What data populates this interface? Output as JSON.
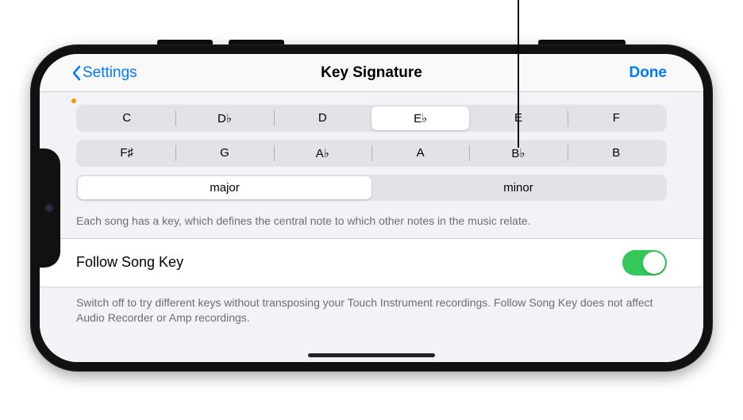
{
  "navbar": {
    "back_label": "Settings",
    "title": "Key Signature",
    "done_label": "Done"
  },
  "keys_row1": [
    {
      "label": "C",
      "selected": false
    },
    {
      "label": "D♭",
      "selected": false
    },
    {
      "label": "D",
      "selected": false
    },
    {
      "label": "E♭",
      "selected": true
    },
    {
      "label": "E",
      "selected": false
    },
    {
      "label": "F",
      "selected": false
    }
  ],
  "keys_row2": [
    {
      "label": "F♯",
      "selected": false
    },
    {
      "label": "G",
      "selected": false
    },
    {
      "label": "A♭",
      "selected": false
    },
    {
      "label": "A",
      "selected": false
    },
    {
      "label": "B♭",
      "selected": false
    },
    {
      "label": "B",
      "selected": false
    }
  ],
  "scale": [
    {
      "label": "major",
      "selected": true
    },
    {
      "label": "minor",
      "selected": false
    }
  ],
  "key_footnote": "Each song has a key, which defines the central note to which other notes in the music relate.",
  "follow": {
    "label": "Follow Song Key",
    "on": true,
    "footnote": "Switch off to try different keys without transposing your Touch Instrument recordings. Follow Song Key does not affect Audio Recorder or Amp recordings."
  }
}
